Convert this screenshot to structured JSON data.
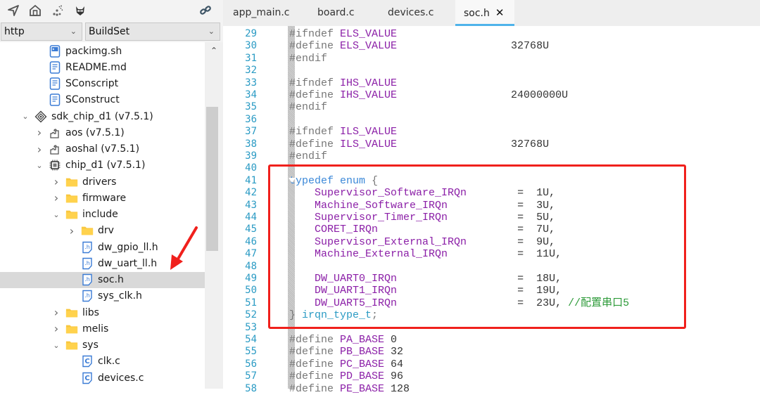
{
  "toolbar": {
    "icons": [
      "navigate-icon",
      "home-icon",
      "magic-wand-icon",
      "raccoon-icon",
      "link-icon"
    ],
    "package_select": "http",
    "build_select": "BuildSet"
  },
  "tree": {
    "items": [
      {
        "label": "packimg.sh",
        "type": "script-file",
        "depth": 2,
        "expanded": null
      },
      {
        "label": "README.md",
        "type": "text-file",
        "depth": 2,
        "expanded": null
      },
      {
        "label": "SConscript",
        "type": "text-file",
        "depth": 2,
        "expanded": null
      },
      {
        "label": "SConstruct",
        "type": "text-file",
        "depth": 2,
        "expanded": null
      },
      {
        "label": "sdk_chip_d1 (v7.5.1)",
        "type": "sdk",
        "depth": 1,
        "expanded": true
      },
      {
        "label": "aos (v7.5.1)",
        "type": "component",
        "depth": 2,
        "expanded": false
      },
      {
        "label": "aoshal (v7.5.1)",
        "type": "component",
        "depth": 2,
        "expanded": false
      },
      {
        "label": "chip_d1 (v7.5.1)",
        "type": "chip",
        "depth": 2,
        "expanded": true
      },
      {
        "label": "drivers",
        "type": "folder",
        "depth": 3,
        "expanded": false
      },
      {
        "label": "firmware",
        "type": "folder",
        "depth": 3,
        "expanded": false
      },
      {
        "label": "include",
        "type": "folder",
        "depth": 3,
        "expanded": true
      },
      {
        "label": "drv",
        "type": "folder",
        "depth": 4,
        "expanded": false
      },
      {
        "label": "dw_gpio_ll.h",
        "type": "h-file",
        "depth": 4,
        "expanded": null
      },
      {
        "label": "dw_uart_ll.h",
        "type": "h-file",
        "depth": 4,
        "expanded": null
      },
      {
        "label": "soc.h",
        "type": "h-file",
        "depth": 4,
        "expanded": null,
        "selected": true
      },
      {
        "label": "sys_clk.h",
        "type": "h-file",
        "depth": 4,
        "expanded": null
      },
      {
        "label": "libs",
        "type": "folder",
        "depth": 3,
        "expanded": false
      },
      {
        "label": "melis",
        "type": "folder",
        "depth": 3,
        "expanded": false
      },
      {
        "label": "sys",
        "type": "folder",
        "depth": 3,
        "expanded": true
      },
      {
        "label": "clk.c",
        "type": "c-file",
        "depth": 4,
        "expanded": null
      },
      {
        "label": "devices.c",
        "type": "c-file",
        "depth": 4,
        "expanded": null
      }
    ]
  },
  "tabs": [
    {
      "label": "app_main.c",
      "active": false
    },
    {
      "label": "board.c",
      "active": false
    },
    {
      "label": "devices.c",
      "active": false
    },
    {
      "label": "soc.h",
      "active": true,
      "close": "✕"
    }
  ],
  "code": {
    "lines": [
      {
        "n": "29",
        "parts": [
          [
            "pp",
            "#ifndef "
          ],
          [
            "mac",
            "ELS_VALUE"
          ]
        ]
      },
      {
        "n": "30",
        "parts": [
          [
            "pp",
            "#define "
          ],
          [
            "mac",
            "ELS_VALUE"
          ],
          [
            "num",
            "                  32768U"
          ]
        ]
      },
      {
        "n": "31",
        "parts": [
          [
            "pp",
            "#endif"
          ]
        ]
      },
      {
        "n": "32",
        "parts": []
      },
      {
        "n": "33",
        "parts": [
          [
            "pp",
            "#ifndef "
          ],
          [
            "mac",
            "IHS_VALUE"
          ]
        ]
      },
      {
        "n": "34",
        "parts": [
          [
            "pp",
            "#define "
          ],
          [
            "mac",
            "IHS_VALUE"
          ],
          [
            "num",
            "                  24000000U"
          ]
        ]
      },
      {
        "n": "35",
        "parts": [
          [
            "pp",
            "#endif"
          ]
        ]
      },
      {
        "n": "36",
        "parts": []
      },
      {
        "n": "37",
        "parts": [
          [
            "pp",
            "#ifndef "
          ],
          [
            "mac",
            "ILS_VALUE"
          ]
        ]
      },
      {
        "n": "38",
        "parts": [
          [
            "pp",
            "#define "
          ],
          [
            "mac",
            "ILS_VALUE"
          ],
          [
            "num",
            "                  32768U"
          ]
        ]
      },
      {
        "n": "39",
        "parts": [
          [
            "pp",
            "#endif"
          ]
        ]
      },
      {
        "n": "40",
        "parts": []
      },
      {
        "n": "41",
        "parts": [
          [
            "kw",
            "typedef enum "
          ],
          [
            "pp",
            "{"
          ]
        ]
      },
      {
        "n": "42",
        "parts": [
          [
            "num",
            "    "
          ],
          [
            "id",
            "Supervisor_Software_IRQn"
          ],
          [
            "num",
            "        =  1U,"
          ]
        ]
      },
      {
        "n": "43",
        "parts": [
          [
            "num",
            "    "
          ],
          [
            "id",
            "Machine_Software_IRQn"
          ],
          [
            "num",
            "           =  3U,"
          ]
        ]
      },
      {
        "n": "44",
        "parts": [
          [
            "num",
            "    "
          ],
          [
            "id",
            "Supervisor_Timer_IRQn"
          ],
          [
            "num",
            "           =  5U,"
          ]
        ]
      },
      {
        "n": "45",
        "parts": [
          [
            "num",
            "    "
          ],
          [
            "id",
            "CORET_IRQn"
          ],
          [
            "num",
            "                      =  7U,"
          ]
        ]
      },
      {
        "n": "46",
        "parts": [
          [
            "num",
            "    "
          ],
          [
            "id",
            "Supervisor_External_IRQn"
          ],
          [
            "num",
            "        =  9U,"
          ]
        ]
      },
      {
        "n": "47",
        "parts": [
          [
            "num",
            "    "
          ],
          [
            "id",
            "Machine_External_IRQn"
          ],
          [
            "num",
            "           =  11U,"
          ]
        ]
      },
      {
        "n": "48",
        "parts": []
      },
      {
        "n": "49",
        "parts": [
          [
            "num",
            "    "
          ],
          [
            "id",
            "DW_UART0_IRQn"
          ],
          [
            "num",
            "                   =  18U,"
          ]
        ]
      },
      {
        "n": "50",
        "parts": [
          [
            "num",
            "    "
          ],
          [
            "id",
            "DW_UART1_IRQn"
          ],
          [
            "num",
            "                   =  19U,"
          ]
        ]
      },
      {
        "n": "51",
        "parts": [
          [
            "num",
            "    "
          ],
          [
            "id",
            "DW_UART5_IRQn"
          ],
          [
            "num",
            "                   =  23U, "
          ],
          [
            "cmt",
            "//配置串口5"
          ]
        ]
      },
      {
        "n": "52",
        "parts": [
          [
            "pp",
            "} "
          ],
          [
            "typ",
            "irqn_type_t"
          ],
          [
            "pp",
            ";"
          ]
        ]
      },
      {
        "n": "53",
        "parts": []
      },
      {
        "n": "54",
        "parts": [
          [
            "pp",
            "#define "
          ],
          [
            "mac",
            "PA_BASE"
          ],
          [
            "num",
            " 0"
          ]
        ]
      },
      {
        "n": "55",
        "parts": [
          [
            "pp",
            "#define "
          ],
          [
            "mac",
            "PB_BASE"
          ],
          [
            "num",
            " 32"
          ]
        ]
      },
      {
        "n": "56",
        "parts": [
          [
            "pp",
            "#define "
          ],
          [
            "mac",
            "PC_BASE"
          ],
          [
            "num",
            " 64"
          ]
        ]
      },
      {
        "n": "57",
        "parts": [
          [
            "pp",
            "#define "
          ],
          [
            "mac",
            "PD_BASE"
          ],
          [
            "num",
            " 96"
          ]
        ]
      },
      {
        "n": "58",
        "parts": [
          [
            "pp",
            "#define "
          ],
          [
            "mac",
            "PE_BASE"
          ],
          [
            "num",
            " 128"
          ]
        ]
      }
    ]
  },
  "annotation": {
    "highlight_color": "#f0201c",
    "highlight_target": "typedef enum irqn_type_t",
    "arrow_target": "soc.h"
  }
}
